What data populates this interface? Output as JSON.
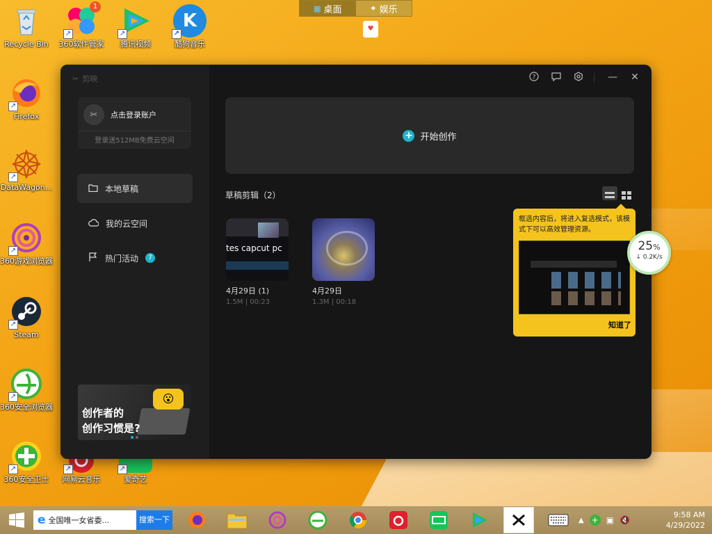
{
  "top_switch": {
    "desktop_label": "桌面",
    "entertain_label": "娱乐"
  },
  "desktop_icons": [
    {
      "label": "Recycle Bin"
    },
    {
      "label": "360软件管家",
      "badge": "1"
    },
    {
      "label": "腾讯视频"
    },
    {
      "label": "酷狗音乐",
      "glyph": "K"
    },
    {
      "label": "Firefox"
    },
    {
      "label": "DataWagon..."
    },
    {
      "label": "360游戏浏览器"
    },
    {
      "label": "Steam"
    },
    {
      "label": "360安全浏览器"
    },
    {
      "label": "360安全卫士"
    },
    {
      "label": "网易云音乐"
    },
    {
      "label": "爱奇艺"
    }
  ],
  "capcut": {
    "logo_text": "剪映",
    "account": {
      "title": "点击登录账户",
      "subtitle": "登录送512MB免费云空间"
    },
    "nav": [
      {
        "label": "本地草稿",
        "icon": "folder-icon"
      },
      {
        "label": "我的云空间",
        "icon": "cloud-icon"
      },
      {
        "label": "热门活动",
        "icon": "flag-icon",
        "badge": "7"
      }
    ],
    "promo": {
      "line1": "创作者的",
      "line2": "创作习惯是?"
    },
    "create_label": "开始创作",
    "drafts_title": "草稿剪辑（2）",
    "drafts": [
      {
        "title": "4月29日 (1)",
        "meta": "1.5M | 00:23",
        "overlay": "tes capcut pc"
      },
      {
        "title": "4月29日",
        "meta": "1.3M | 00:18"
      }
    ]
  },
  "tip": {
    "text": "框选内容后，将进入复选模式，该模式下可以高效管理资源。",
    "button": "知道了"
  },
  "speed": {
    "percent": "25",
    "unit": "%",
    "rate": "↓ 0.2K/s"
  },
  "taskbar": {
    "ie_text": "全国唯一女省委...",
    "search_btn": "搜索一下",
    "time": "9:58 AM",
    "date": "4/29/2022"
  },
  "colors": {
    "accent": "#1fb5c9",
    "tip_bg": "#f4c31e",
    "desktop": "#f4a718"
  }
}
